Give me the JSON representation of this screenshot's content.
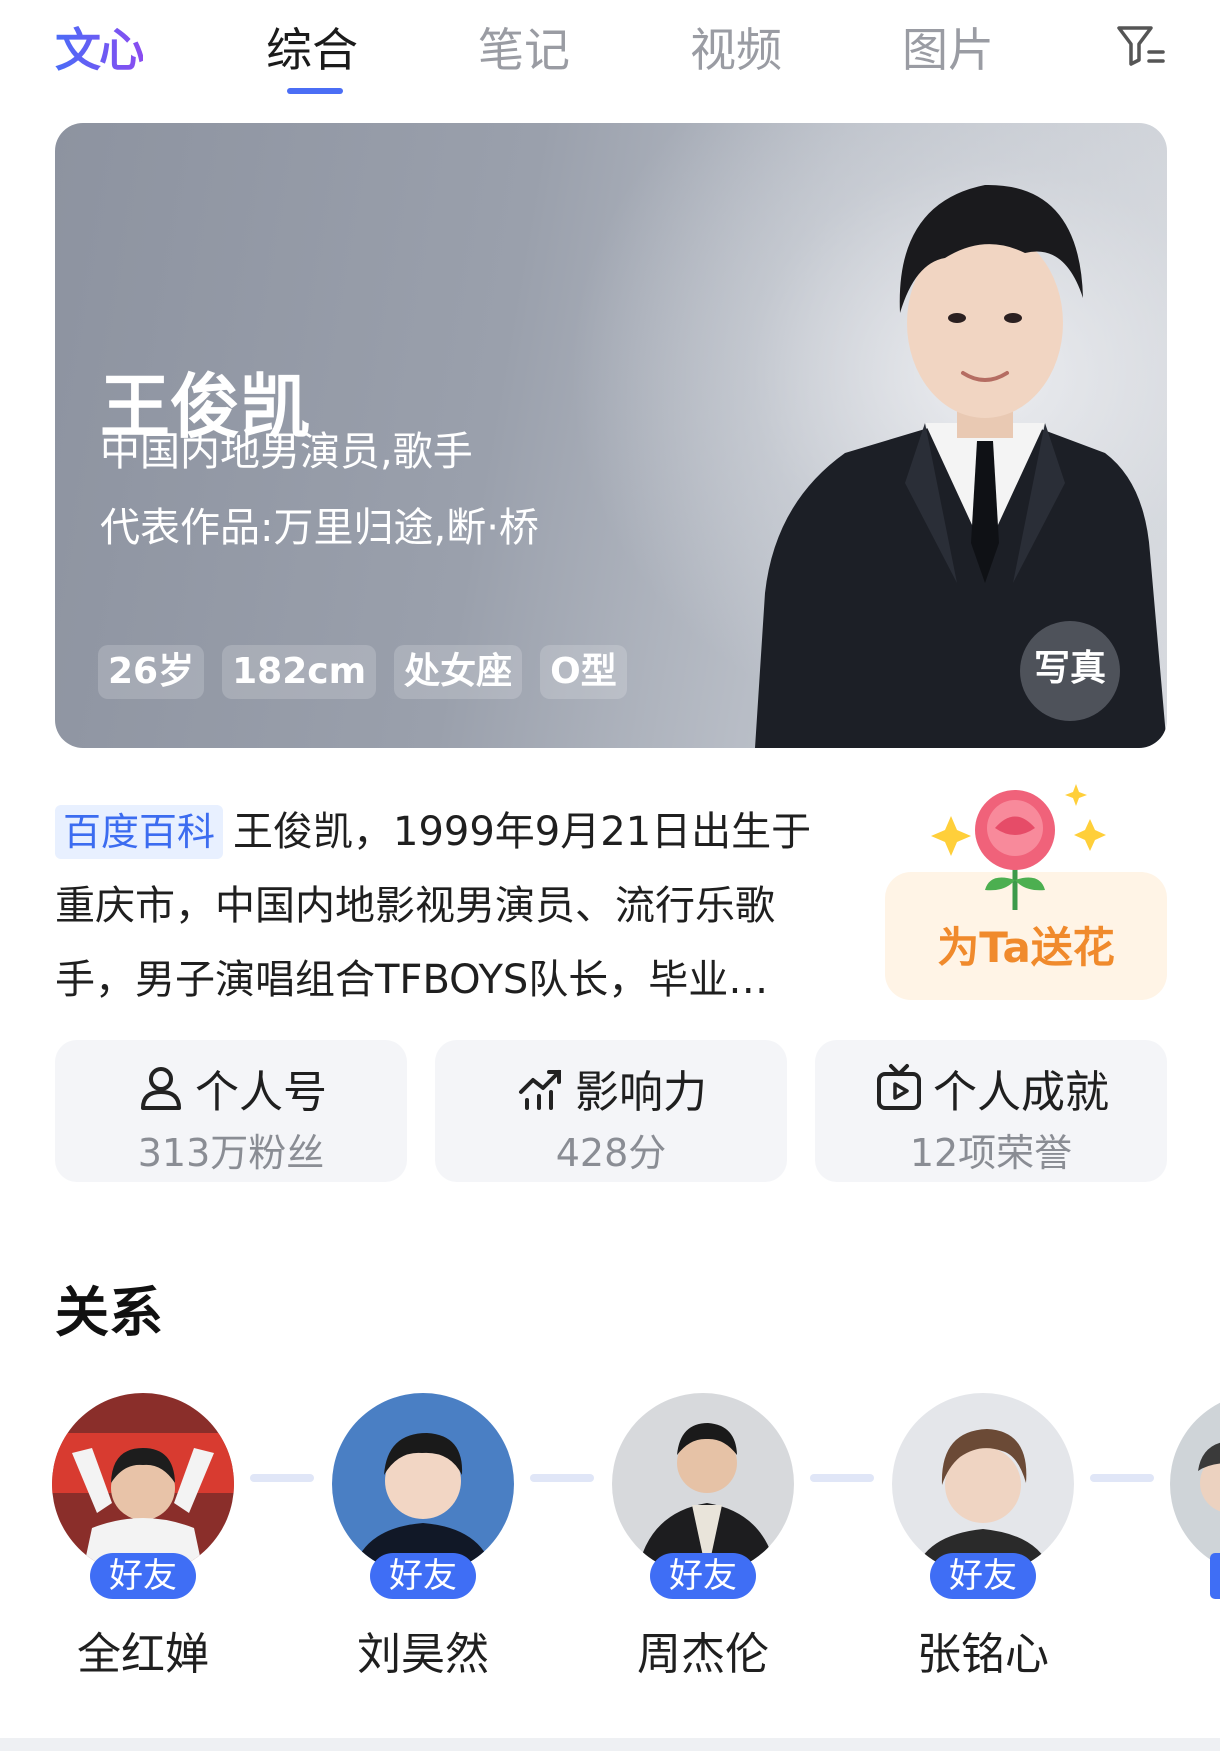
{
  "topbar": {
    "logo": "文心",
    "tabs": [
      {
        "label": "综合",
        "active": true
      },
      {
        "label": "笔记",
        "active": false
      },
      {
        "label": "视频",
        "active": false
      },
      {
        "label": "图片",
        "active": false
      }
    ],
    "filter_icon": "filter-icon",
    "accent_color": "#4b6ef5"
  },
  "hero": {
    "name": "王俊凯",
    "occupation": "中国内地男演员,歌手",
    "works": "代表作品:万里归途,断·桥",
    "tags": [
      "26岁",
      "182cm",
      "处女座",
      "O型"
    ],
    "photo_button": "写真"
  },
  "summary": {
    "source": "百度百科",
    "text_line1": "王俊凯，1999年9月21日出生于",
    "text_line2": "重庆市，中国内地影视男演员、流行乐歌",
    "text_line3": "手，男子演唱组合TFBOYS队长，毕业…"
  },
  "flower": {
    "label": "为Ta送花",
    "color": "#f08a2c"
  },
  "stats": [
    {
      "icon": "person-icon",
      "title": "个人号",
      "sub": "313万粉丝"
    },
    {
      "icon": "trend-chart-icon",
      "title": "影响力",
      "sub": "428分"
    },
    {
      "icon": "tv-play-icon",
      "title": "个人成就",
      "sub": "12项荣誉"
    }
  ],
  "relations": {
    "title": "关系",
    "items": [
      {
        "badge": "好友",
        "name": "全红婵"
      },
      {
        "badge": "好友",
        "name": "刘昊然"
      },
      {
        "badge": "好友",
        "name": "周杰伦"
      },
      {
        "badge": "好友",
        "name": "张铭心"
      }
    ]
  }
}
